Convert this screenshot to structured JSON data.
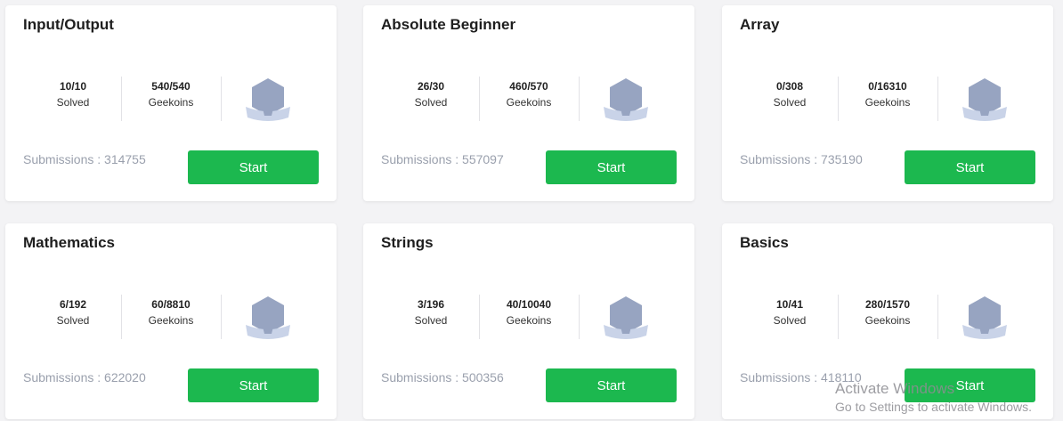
{
  "cards": [
    {
      "title": "Input/Output",
      "solved": "10/10",
      "solved_label": "Solved",
      "geekoins": "540/540",
      "geekoins_label": "Geekoins",
      "submissions": "Submissions : 314755",
      "button": "Start"
    },
    {
      "title": "Absolute Beginner",
      "solved": "26/30",
      "solved_label": "Solved",
      "geekoins": "460/570",
      "geekoins_label": "Geekoins",
      "submissions": "Submissions : 557097",
      "button": "Start"
    },
    {
      "title": "Array",
      "solved": "0/308",
      "solved_label": "Solved",
      "geekoins": "0/16310",
      "geekoins_label": "Geekoins",
      "submissions": "Submissions : 735190",
      "button": "Start"
    },
    {
      "title": "Mathematics",
      "solved": "6/192",
      "solved_label": "Solved",
      "geekoins": "60/8810",
      "geekoins_label": "Geekoins",
      "submissions": "Submissions : 622020",
      "button": "Start"
    },
    {
      "title": "Strings",
      "solved": "3/196",
      "solved_label": "Solved",
      "geekoins": "40/10040",
      "geekoins_label": "Geekoins",
      "submissions": "Submissions : 500356",
      "button": "Start"
    },
    {
      "title": "Basics",
      "solved": "10/41",
      "solved_label": "Solved",
      "geekoins": "280/1570",
      "geekoins_label": "Geekoins",
      "submissions": "Submissions : 418110",
      "button": "Start"
    }
  ],
  "badge_icon": "badge-icon",
  "colors": {
    "button": "#1cb84f",
    "badge": "#97a4c1",
    "ribbon": "#c9d3e8"
  },
  "watermark": {
    "line1": "Activate Windows",
    "line2": "Go to Settings to activate Windows."
  }
}
